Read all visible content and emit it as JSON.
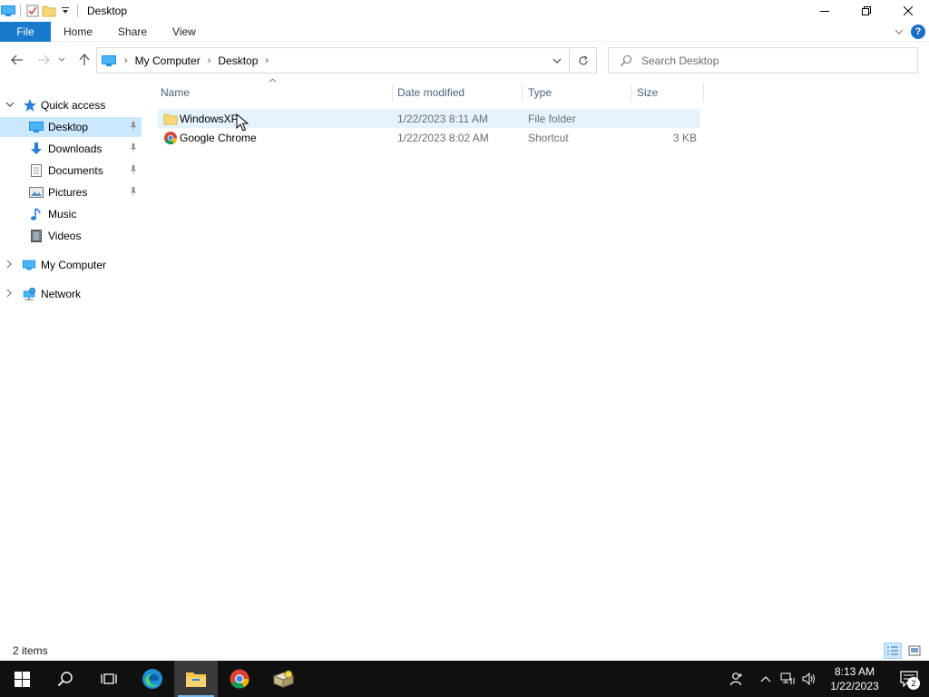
{
  "window": {
    "title": "Desktop"
  },
  "ribbon": {
    "file": "File",
    "tabs": [
      "Home",
      "Share",
      "View"
    ]
  },
  "address": {
    "crumbs": [
      "My Computer",
      "Desktop"
    ]
  },
  "search": {
    "placeholder": "Search Desktop"
  },
  "nav": {
    "quick_access": "Quick access",
    "items": [
      {
        "label": "Desktop",
        "icon": "desktop-icon",
        "pinned": true
      },
      {
        "label": "Downloads",
        "icon": "downloads-icon",
        "pinned": true
      },
      {
        "label": "Documents",
        "icon": "documents-icon",
        "pinned": true
      },
      {
        "label": "Pictures",
        "icon": "pictures-icon",
        "pinned": true
      },
      {
        "label": "Music",
        "icon": "music-icon",
        "pinned": false
      },
      {
        "label": "Videos",
        "icon": "videos-icon",
        "pinned": false
      }
    ],
    "my_computer": "My Computer",
    "network": "Network"
  },
  "columns": {
    "name": "Name",
    "date": "Date modified",
    "type": "Type",
    "size": "Size"
  },
  "files": [
    {
      "name": "WindowsXP",
      "date": "1/22/2023 8:11 AM",
      "type": "File folder",
      "size": "",
      "icon": "folder-icon"
    },
    {
      "name": "Google Chrome",
      "date": "1/22/2023 8:02 AM",
      "type": "Shortcut",
      "size": "3 KB",
      "icon": "chrome-icon"
    }
  ],
  "status": {
    "items": "2 items"
  },
  "clock": {
    "time": "8:13 AM",
    "date": "1/22/2023"
  },
  "notifications": {
    "count": "2"
  },
  "colors": {
    "accent": "#1979ca",
    "selection": "#cce8ff",
    "taskbar": "#101010"
  }
}
